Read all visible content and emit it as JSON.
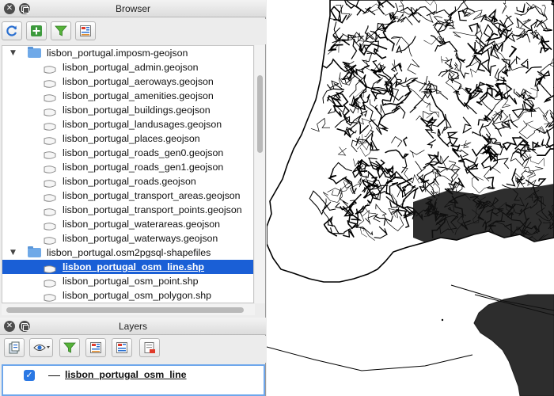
{
  "browser_panel": {
    "title": "Browser",
    "toolbar": [
      {
        "name": "refresh-button",
        "icon": "refresh-icon"
      },
      {
        "name": "add-layer-button",
        "icon": "add-icon"
      },
      {
        "name": "filter-button",
        "icon": "filter-icon"
      },
      {
        "name": "collapse-all-button",
        "icon": "collapse-all-icon"
      }
    ],
    "tree": [
      {
        "type": "folder",
        "label": "lisbon_portugal.imposm-geojson",
        "expanded": true
      },
      {
        "type": "file",
        "label": "lisbon_portugal_admin.geojson"
      },
      {
        "type": "file",
        "label": "lisbon_portugal_aeroways.geojson"
      },
      {
        "type": "file",
        "label": "lisbon_portugal_amenities.geojson"
      },
      {
        "type": "file",
        "label": "lisbon_portugal_buildings.geojson"
      },
      {
        "type": "file",
        "label": "lisbon_portugal_landusages.geojson"
      },
      {
        "type": "file",
        "label": "lisbon_portugal_places.geojson"
      },
      {
        "type": "file",
        "label": "lisbon_portugal_roads_gen0.geojson"
      },
      {
        "type": "file",
        "label": "lisbon_portugal_roads_gen1.geojson"
      },
      {
        "type": "file",
        "label": "lisbon_portugal_roads.geojson"
      },
      {
        "type": "file",
        "label": "lisbon_portugal_transport_areas.geojson"
      },
      {
        "type": "file",
        "label": "lisbon_portugal_transport_points.geojson"
      },
      {
        "type": "file",
        "label": "lisbon_portugal_waterareas.geojson"
      },
      {
        "type": "file",
        "label": "lisbon_portugal_waterways.geojson"
      },
      {
        "type": "folder",
        "label": "lisbon_portugal.osm2pgsql-shapefiles",
        "expanded": true
      },
      {
        "type": "file",
        "label": "lisbon_portugal_osm_line.shp",
        "selected": true
      },
      {
        "type": "file",
        "label": "lisbon_portugal_osm_point.shp"
      },
      {
        "type": "file",
        "label": "lisbon_portugal_osm_polygon.shp"
      }
    ]
  },
  "layers_panel": {
    "title": "Layers",
    "toolbar": [
      {
        "name": "open-layer-styling-button",
        "icon": "layer-styling-icon"
      },
      {
        "name": "manage-visibility-button",
        "icon": "eye-icon"
      },
      {
        "name": "filter-legend-button",
        "icon": "filter-icon"
      },
      {
        "name": "expand-all-button",
        "icon": "expand-all-icon"
      },
      {
        "name": "collapse-all-layers-button",
        "icon": "collapse-all-icon"
      },
      {
        "name": "remove-layer-button",
        "icon": "remove-layer-icon"
      }
    ],
    "layers": [
      {
        "label": "lisbon_portugal_osm_line",
        "checked": true,
        "check_glyph": "✓"
      }
    ]
  },
  "window_controls": {
    "close_glyph": "✕"
  },
  "colors": {
    "selection": "#1a5fd6",
    "accent": "#2a78e4",
    "map_background": "#ffffff",
    "map_lines": "#000000"
  }
}
